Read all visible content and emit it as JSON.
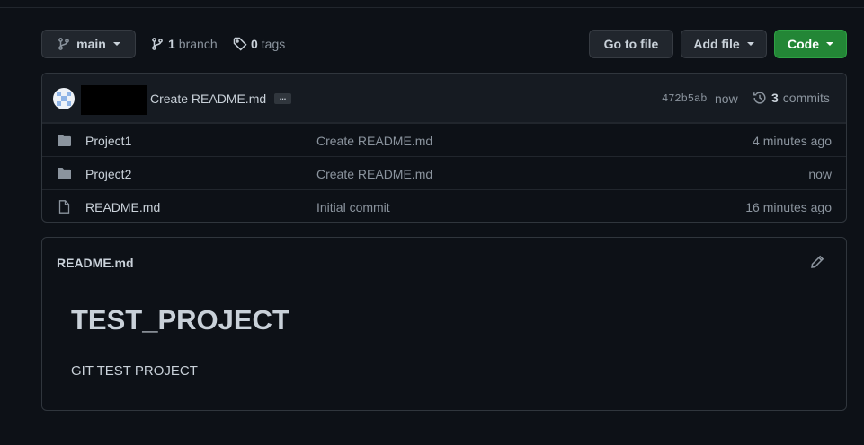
{
  "toolbar": {
    "branch_name": "main",
    "branch_count": "1",
    "branch_label": "branch",
    "tag_count": "0",
    "tag_label": "tags",
    "goto_label": "Go to file",
    "addfile_label": "Add file",
    "code_label": "Code"
  },
  "latest_commit": {
    "message": "Create README.md",
    "ellipsis": "...",
    "sha": "472b5ab",
    "time": "now",
    "commit_count": "3",
    "commit_label": "commits"
  },
  "files": [
    {
      "name": "Project1",
      "type": "folder",
      "commit": "Create README.md",
      "time": "4 minutes ago"
    },
    {
      "name": "Project2",
      "type": "folder",
      "commit": "Create README.md",
      "time": "now"
    },
    {
      "name": "README.md",
      "type": "file",
      "commit": "Initial commit",
      "time": "16 minutes ago"
    }
  ],
  "readme": {
    "filename": "README.md",
    "heading": "TEST_PROJECT",
    "body": "GIT TEST PROJECT"
  },
  "colors": {
    "background": "#0d1117",
    "code_button": "#238636",
    "folder_icon": "#8b949e"
  }
}
